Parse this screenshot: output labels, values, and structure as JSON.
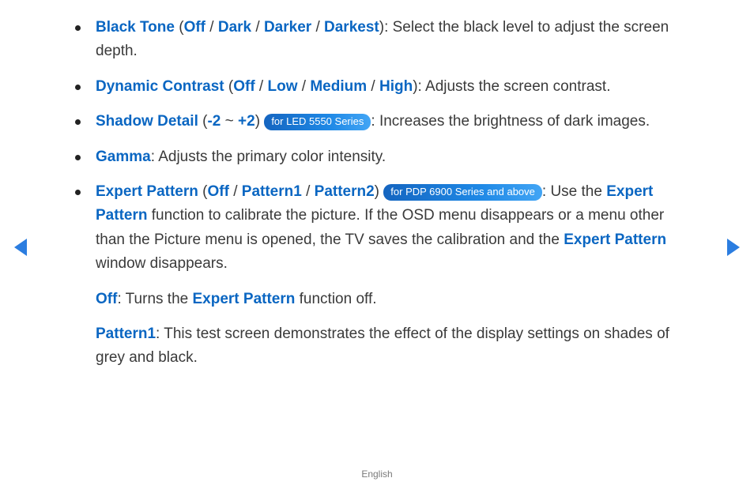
{
  "footer": {
    "language": "English"
  },
  "nav": {
    "prev_icon_name": "previous-page",
    "next_icon_name": "next-page"
  },
  "items": [
    {
      "name": "Black Tone",
      "options": [
        "Off",
        "Dark",
        "Darker",
        "Darkest"
      ],
      "desc": ": Select the black level to adjust the screen depth."
    },
    {
      "name": "Dynamic Contrast",
      "options": [
        "Off",
        "Low",
        "Medium",
        "High"
      ],
      "desc": ": Adjusts the screen contrast."
    },
    {
      "name": "Shadow Detail",
      "range": {
        "lo": "-2",
        "sep": " ~ ",
        "hi": "+2"
      },
      "badge": "for LED 5550 Series",
      "desc": ": Increases the brightness of dark images."
    },
    {
      "name": "Gamma",
      "desc": ": Adjusts the primary color intensity."
    },
    {
      "name": "Expert Pattern",
      "options": [
        "Off",
        "Pattern1",
        "Pattern2"
      ],
      "badge": "for PDP 6900 Series and above",
      "desc_parts": {
        "p1": ": Use the ",
        "kw1": "Expert Pattern",
        "p2": " function to calibrate the picture. If the OSD menu disappears or a menu other than the Picture menu is opened, the TV saves the calibration and the ",
        "kw2": "Expert Pattern",
        "p3": " window disappears."
      },
      "subs": [
        {
          "label": "Off",
          "p1": ": Turns the ",
          "kw": "Expert Pattern",
          "p2": " function off."
        },
        {
          "label": "Pattern1",
          "p1": ": This test screen demonstrates the effect of the display settings on shades of grey and black."
        }
      ]
    }
  ]
}
